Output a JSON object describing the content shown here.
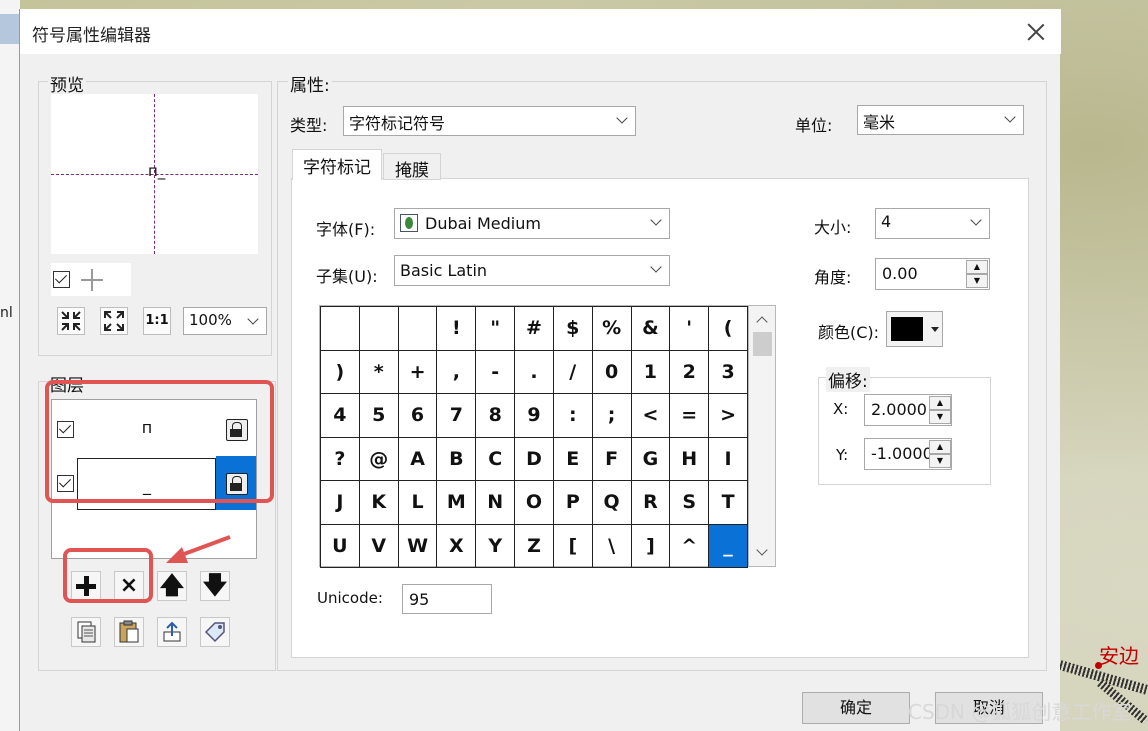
{
  "window": {
    "title": "符号属性编辑器"
  },
  "background": {
    "left_text": "nl",
    "map_label": "安边",
    "watermark": "CSDN @狐狐创意工作室"
  },
  "preview": {
    "label": "预览",
    "symbol": "п_",
    "zoom": "100%",
    "buttons": [
      "zoom-in",
      "zoom-out",
      "1:1"
    ],
    "one_to_one_label": "1:1"
  },
  "layers": {
    "label": "图层",
    "items": [
      {
        "checked": true,
        "symbol": "п",
        "selected": false
      },
      {
        "checked": true,
        "symbol": "_",
        "selected": true
      }
    ],
    "actions": {
      "add": "add-layer",
      "remove": "remove-layer",
      "up": "move-up",
      "down": "move-down",
      "remove_glyph": "×",
      "up_glyph": "🡅",
      "down_glyph": "🡇"
    }
  },
  "properties": {
    "label": "属性:",
    "type_label": "类型:",
    "type_value": "字符标记符号",
    "unit_label": "单位:",
    "unit_value": "毫米",
    "tabs": [
      "字符标记",
      "掩膜"
    ],
    "font_label": "字体(F):",
    "font_value": "Dubai Medium",
    "subset_label": "子集(U):",
    "subset_value": "Basic Latin",
    "unicode_label": "Unicode:",
    "unicode_value": "95",
    "size_label": "大小:",
    "size_value": "4",
    "angle_label": "角度:",
    "angle_value": "0.00",
    "color_label": "颜色(C):",
    "color_value": "#000000",
    "offset_label": "偏移:",
    "offset_x_label": "X:",
    "offset_x_value": "2.0000",
    "offset_y_label": "Y:",
    "offset_y_value": "-1.0000"
  },
  "char_grid": [
    [
      "",
      "",
      "",
      "!",
      "\"",
      "#",
      "$",
      "%",
      "&",
      "'",
      "("
    ],
    [
      ")",
      "*",
      "+",
      ",",
      "-",
      ".",
      "/",
      "0",
      "1",
      "2",
      "3"
    ],
    [
      "4",
      "5",
      "6",
      "7",
      "8",
      "9",
      ":",
      ";",
      "<",
      "=",
      ">"
    ],
    [
      "?",
      "@",
      "A",
      "B",
      "C",
      "D",
      "E",
      "F",
      "G",
      "H",
      "I"
    ],
    [
      "J",
      "K",
      "L",
      "M",
      "N",
      "O",
      "P",
      "Q",
      "R",
      "S",
      "T"
    ],
    [
      "U",
      "V",
      "W",
      "X",
      "Y",
      "Z",
      "[",
      "\\",
      "]",
      "^",
      "_"
    ]
  ],
  "selected_char": "_",
  "footer": {
    "ok": "确定",
    "cancel": "取消"
  }
}
